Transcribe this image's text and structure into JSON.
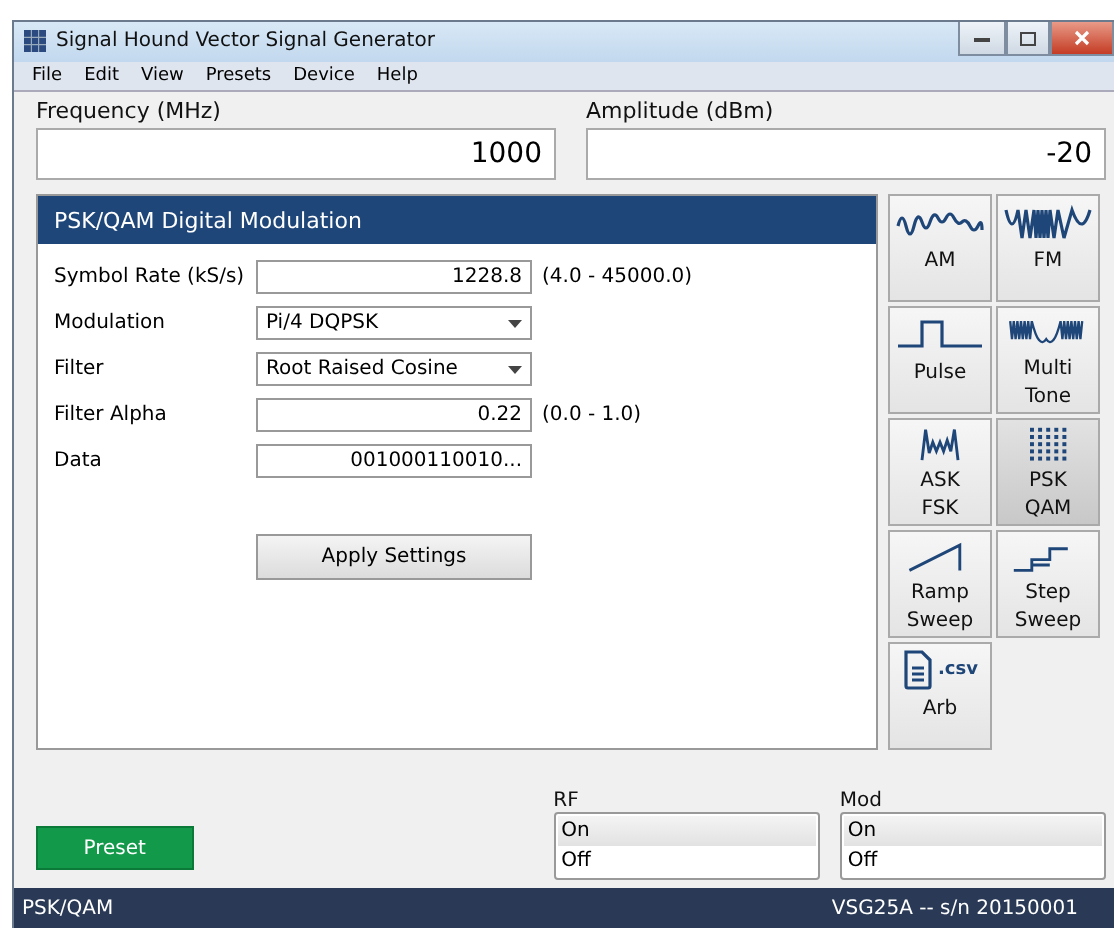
{
  "window": {
    "title": "Signal Hound Vector Signal Generator"
  },
  "menu": [
    "File",
    "Edit",
    "View",
    "Presets",
    "Device",
    "Help"
  ],
  "frequency": {
    "label": "Frequency (MHz)",
    "value": "1000"
  },
  "amplitude": {
    "label": "Amplitude (dBm)",
    "value": "-20"
  },
  "panel": {
    "title": "PSK/QAM Digital Modulation",
    "fields": [
      {
        "kind": "input",
        "label": "Symbol Rate (kS/s)",
        "value": "1228.8",
        "range": "(4.0 - 45000.0)"
      },
      {
        "kind": "dropdown",
        "label": "Modulation",
        "value": "Pi/4 DQPSK"
      },
      {
        "kind": "dropdown",
        "label": "Filter",
        "value": "Root Raised Cosine"
      },
      {
        "kind": "input",
        "label": "Filter Alpha",
        "value": "0.22",
        "range": "(0.0 - 1.0)"
      },
      {
        "kind": "input",
        "label": "Data",
        "value": "001000110010..."
      }
    ],
    "apply_button": "Apply Settings"
  },
  "modes": [
    {
      "kind": "am",
      "label": "AM",
      "selected": false
    },
    {
      "kind": "fm",
      "label": "FM",
      "selected": false
    },
    {
      "kind": "pulse",
      "label": "Pulse",
      "selected": false
    },
    {
      "kind": "multitone",
      "label": "Multi Tone",
      "selected": false
    },
    {
      "kind": "askfsk",
      "label": "ASK FSK",
      "selected": false
    },
    {
      "kind": "pskqam",
      "label": "PSK QAM",
      "selected": true
    },
    {
      "kind": "ramp",
      "label": "Ramp Sweep",
      "selected": false
    },
    {
      "kind": "step",
      "label": "Step Sweep",
      "selected": false
    },
    {
      "kind": "arb",
      "label": "Arb",
      "selected": false,
      "icon_text": ".csv"
    }
  ],
  "preset_button": "Preset",
  "rf": {
    "label": "RF",
    "options": [
      {
        "label": "On",
        "selected": true
      },
      {
        "label": "Off",
        "selected": false
      }
    ]
  },
  "mod": {
    "label": "Mod",
    "options": [
      {
        "label": "On",
        "selected": true
      },
      {
        "label": "Off",
        "selected": false
      }
    ]
  },
  "status_bar": {
    "left": "PSK/QAM",
    "right": "VSG25A -- s/n 20150001"
  }
}
